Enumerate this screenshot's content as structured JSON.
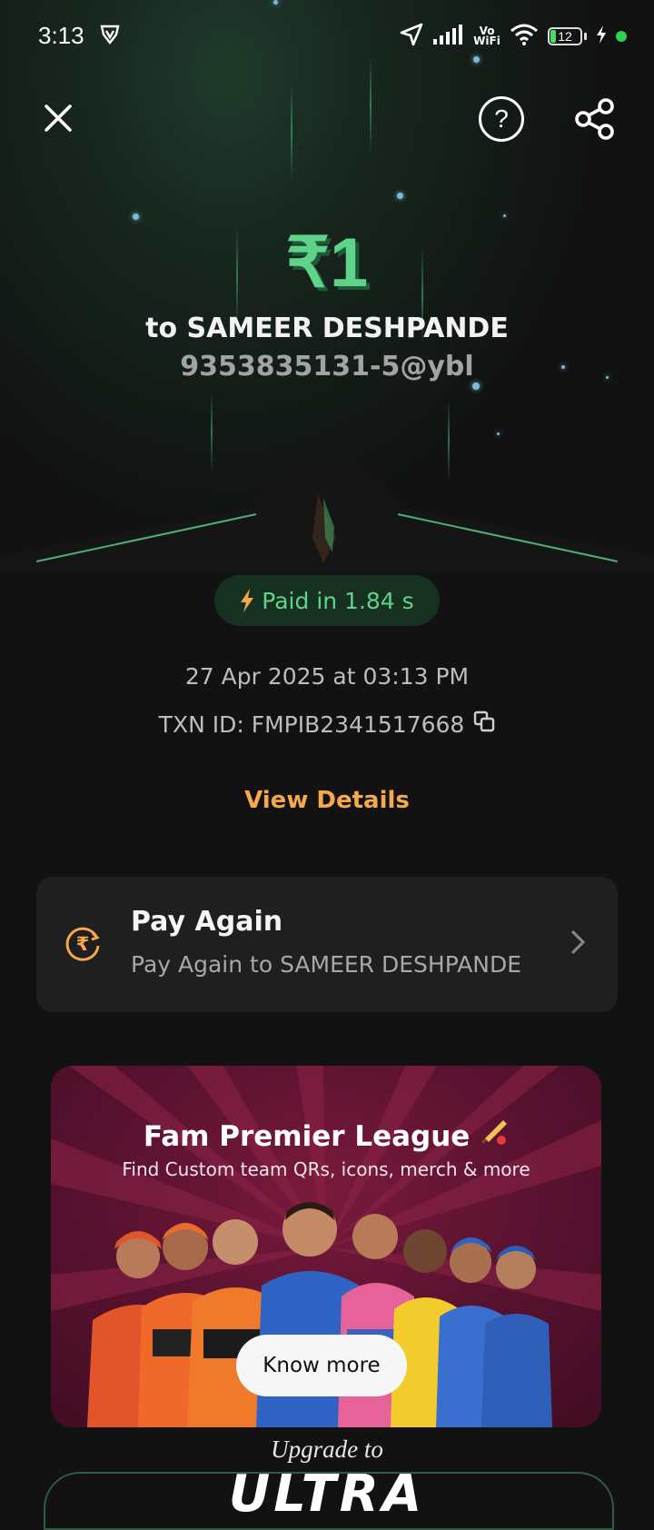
{
  "status_bar": {
    "time": "3:13",
    "battery": "12",
    "network_label": "Vo WiFi"
  },
  "header": {
    "help_symbol": "?"
  },
  "payment": {
    "amount": "₹1",
    "recipient_line": "to SAMEER DESHPANDE",
    "upi_id": "9353835131-5@ybl",
    "paid_badge": "Paid in 1.84 s",
    "datetime": "27 Apr 2025 at 03:13 PM",
    "txn_id": "TXN ID: FMPIB2341517668",
    "view_details": "View Details"
  },
  "pay_again": {
    "title": "Pay Again",
    "subtitle": "Pay Again to SAMEER DESHPANDE"
  },
  "banner": {
    "title": "Fam Premier League",
    "subtitle": "Find Custom team QRs, icons, merch & more",
    "cta": "Know more"
  },
  "footer": {
    "upgrade_text": "Upgrade to",
    "ultra_text": "ULTRA"
  },
  "colors": {
    "accent_green": "#5fd38a",
    "accent_orange": "#f6a94a",
    "background": "#111211",
    "card": "#1f1f1f"
  },
  "icons": [
    "vpn-icon",
    "location-icon",
    "signal-icon",
    "wifi-icon",
    "battery-icon",
    "close-icon",
    "help-icon",
    "share-icon",
    "bolt-icon",
    "copy-icon",
    "rupee-refresh-icon",
    "chevron-right-icon",
    "cricket-bat-icon"
  ]
}
